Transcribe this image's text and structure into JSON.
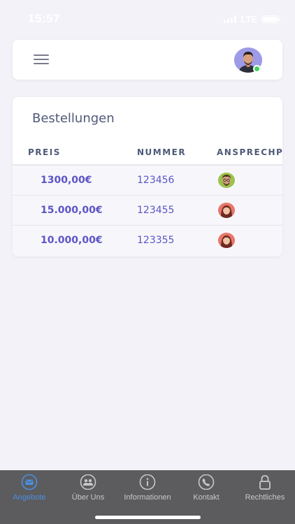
{
  "status_bar": {
    "time": "15:57",
    "network": "LTE"
  },
  "header": {
    "menu_icon": "hamburger-icon",
    "avatar": "user-avatar",
    "online_color": "#43d15d"
  },
  "orders": {
    "title": "Bestellungen",
    "columns": [
      "PREIS",
      "NUMMER",
      "ANSPRECHP"
    ],
    "rows": [
      {
        "price": "1300,00€",
        "number": "123456",
        "contact_avatar": "male-contact-avatar"
      },
      {
        "price": "15.000,00€",
        "number": "123455",
        "contact_avatar": "female-contact-avatar"
      },
      {
        "price": "10.000,00€",
        "number": "123355",
        "contact_avatar": "female-contact-avatar"
      }
    ]
  },
  "tabbar": {
    "active_color": "#4a90e2",
    "tabs": [
      {
        "label": "Angebote",
        "icon": "mail-icon",
        "active": true
      },
      {
        "label": "Über Uns",
        "icon": "people-icon",
        "active": false
      },
      {
        "label": "Informationen",
        "icon": "info-icon",
        "active": false
      },
      {
        "label": "Kontakt",
        "icon": "phone-icon",
        "active": false
      },
      {
        "label": "Rechtliches",
        "icon": "lock-icon",
        "active": false
      }
    ]
  }
}
